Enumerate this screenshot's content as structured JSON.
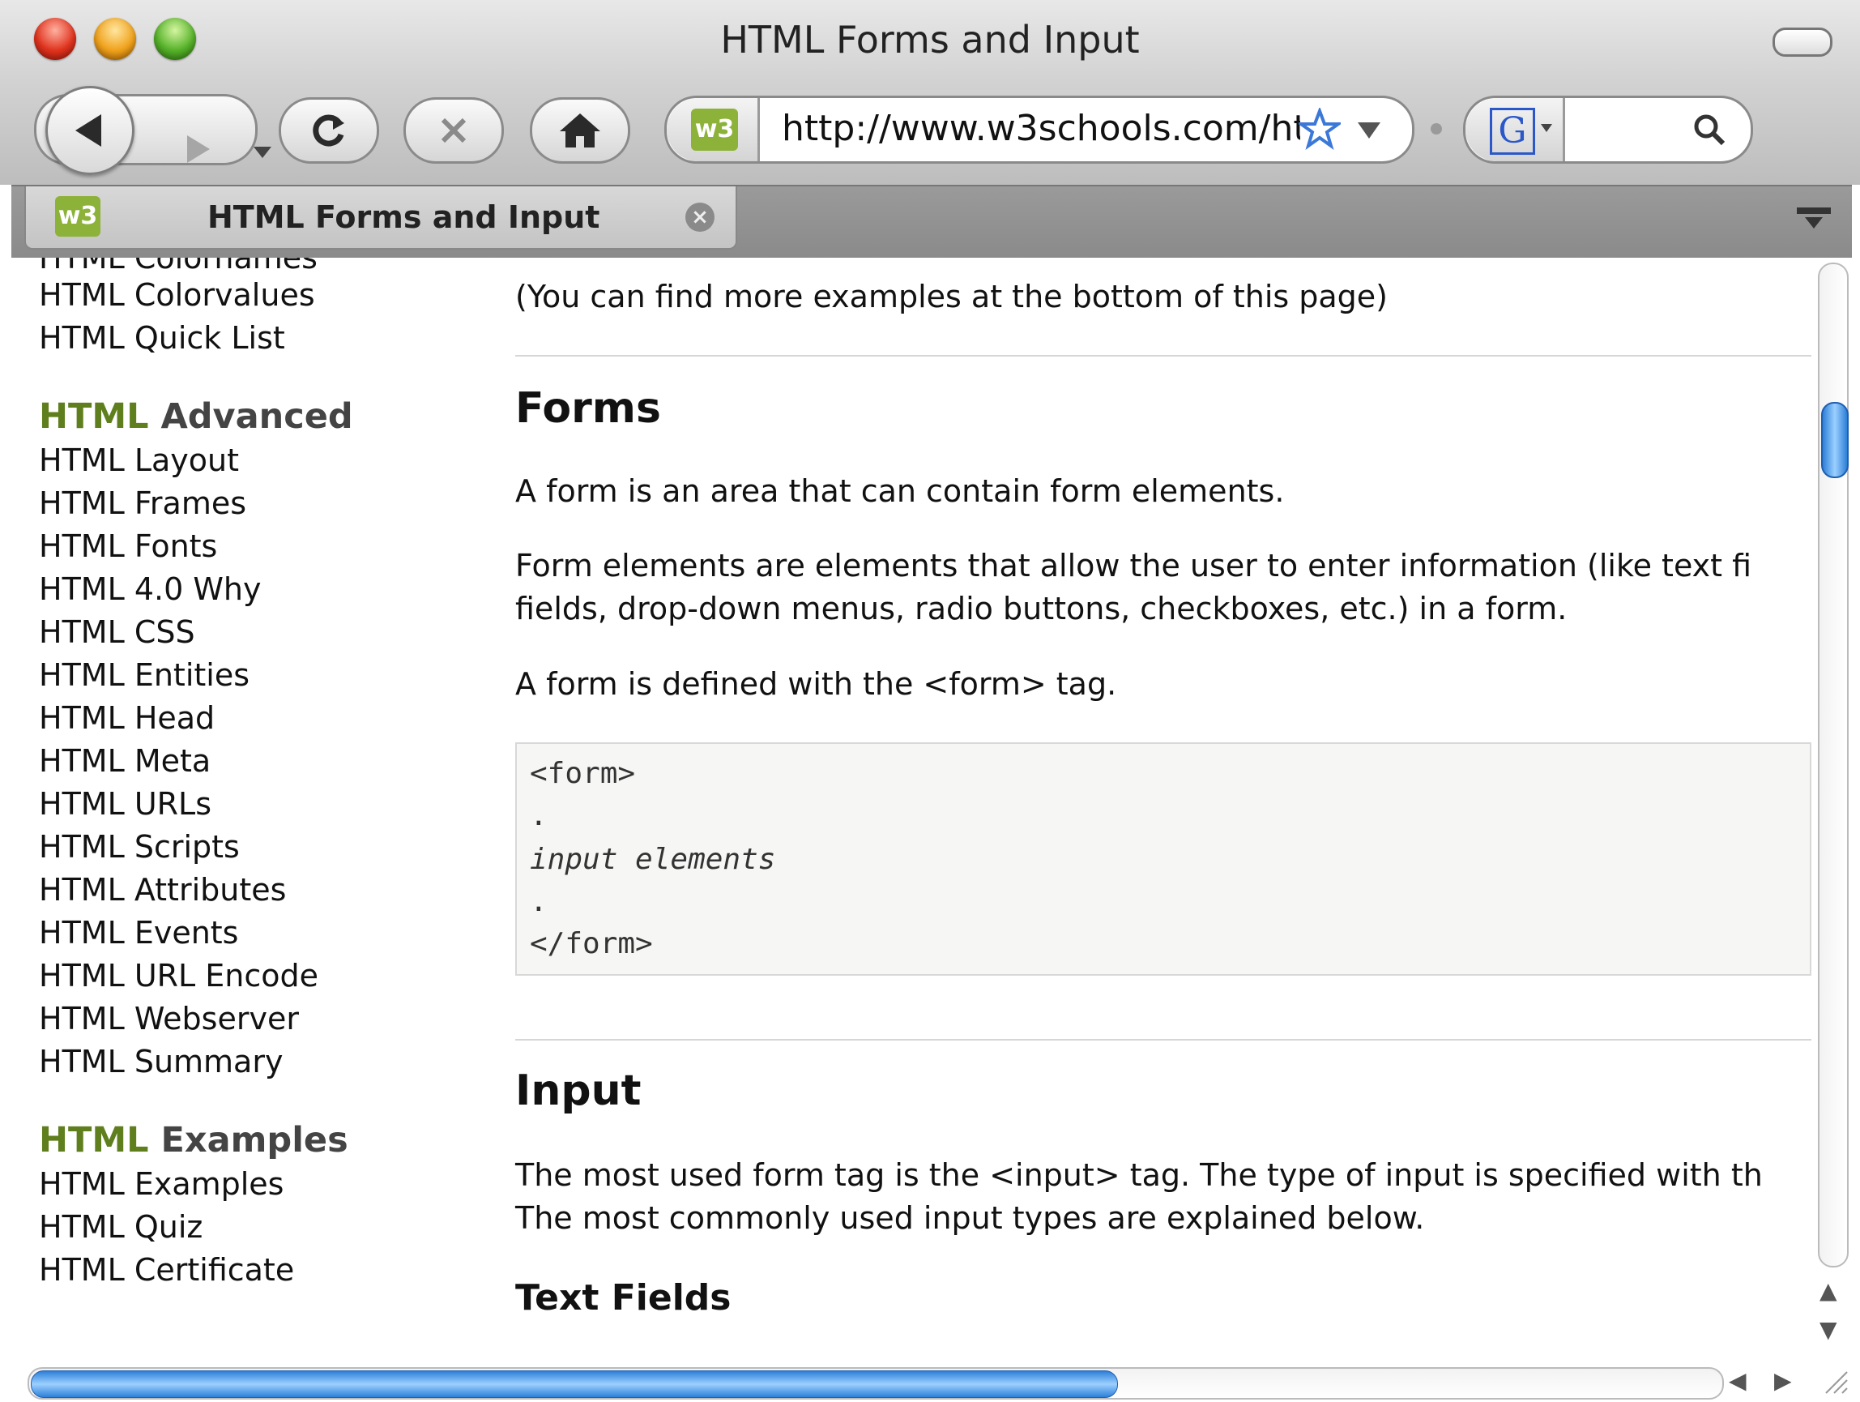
{
  "window": {
    "title": "HTML Forms and Input"
  },
  "toolbar": {
    "url": "http://www.w3schools.com/ht",
    "site_icon": "w3"
  },
  "search": {
    "engine_icon": "G"
  },
  "tab": {
    "label": "HTML Forms and Input",
    "close": "×",
    "icon": "w3"
  },
  "sidebar": {
    "cut_item": "HTML Colornames",
    "items_top": [
      "HTML Colorvalues",
      "HTML Quick List"
    ],
    "advanced_heading_a": "HTML",
    "advanced_heading_b": " Advanced",
    "advanced_items": [
      "HTML Layout",
      "HTML Frames",
      "HTML Fonts",
      "HTML 4.0 Why",
      "HTML CSS",
      "HTML Entities",
      "HTML Head",
      "HTML Meta",
      "HTML URLs",
      "HTML Scripts",
      "HTML Attributes",
      "HTML Events",
      "HTML URL Encode",
      "HTML Webserver",
      "HTML Summary"
    ],
    "examples_heading_a": "HTML",
    "examples_heading_b": " Examples",
    "examples_items": [
      "HTML Examples",
      "HTML Quiz",
      "HTML Certificate"
    ]
  },
  "main": {
    "intro": "(You can find more examples at the bottom of this page)",
    "forms_heading": "Forms",
    "forms_p1": "A form is an area that can contain form elements.",
    "forms_p2_line1": "Form elements are elements that allow the user to enter information (like text fi",
    "forms_p2_line2": "fields, drop-down menus, radio buttons, checkboxes, etc.) in a form.",
    "forms_p3": "A form is defined with the <form> tag.",
    "code": [
      "<form>",
      ".",
      "input elements",
      ".",
      "</form>"
    ],
    "input_heading": "Input",
    "input_p1_line1": "The most used form tag is the <input> tag. The type of input is specified with th",
    "input_p1_line2": "The most commonly used input types are explained below.",
    "text_fields_heading": "Text Fields"
  }
}
